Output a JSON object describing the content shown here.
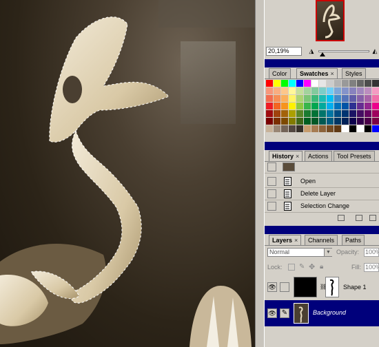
{
  "navigator": {
    "zoom": "20,19%"
  },
  "color_panel": {
    "tabs": [
      {
        "label": "Color",
        "active": false
      },
      {
        "label": "Swatches",
        "active": true
      },
      {
        "label": "Styles",
        "active": false
      }
    ],
    "swatch_colors": [
      "#ff0000",
      "#ffff00",
      "#00ff00",
      "#00ffff",
      "#0000ff",
      "#ff00ff",
      "#ffffff",
      "#e6e6e6",
      "#cccccc",
      "#b3b3b3",
      "#999999",
      "#808080",
      "#666666",
      "#4d4d4d",
      "#333333",
      "#f7977a",
      "#f9ad81",
      "#fdc68a",
      "#fff79a",
      "#c4df9b",
      "#a2d39c",
      "#82ca9d",
      "#7bcdc8",
      "#6ecff6",
      "#7ea7d8",
      "#8493ca",
      "#8882be",
      "#a187be",
      "#bc8dbf",
      "#f49ac2",
      "#f26c4f",
      "#f68e55",
      "#fbaf5c",
      "#fff467",
      "#acd372",
      "#7cc576",
      "#3bb878",
      "#1abbb4",
      "#00bff3",
      "#438cca",
      "#5574b9",
      "#605ca8",
      "#855fa8",
      "#a763a8",
      "#f06ea9",
      "#ed1c24",
      "#f26522",
      "#f7941d",
      "#fff200",
      "#8dc73f",
      "#39b54a",
      "#00a651",
      "#00a99d",
      "#00aeef",
      "#0072bc",
      "#0054a6",
      "#2e3192",
      "#662d91",
      "#92278f",
      "#ec008c",
      "#9e0b0f",
      "#a0410d",
      "#a3620a",
      "#aba000",
      "#598527",
      "#1a7b30",
      "#007236",
      "#00746b",
      "#0076a3",
      "#004b80",
      "#003471",
      "#1b1464",
      "#440e62",
      "#630460",
      "#9e005d",
      "#790000",
      "#7b2e00",
      "#7d4900",
      "#827b00",
      "#406618",
      "#005e20",
      "#005826",
      "#005952",
      "#005b7f",
      "#003663",
      "#002157",
      "#0d004c",
      "#32004b",
      "#4b0049",
      "#7b0046",
      "#c7b299",
      "#998675",
      "#736357",
      "#534741",
      "#37302a",
      "#c69c6d",
      "#a67c52",
      "#8c6239",
      "#754c24",
      "#603913",
      "#ffffff",
      "#000000",
      "#ffffff",
      "#000000",
      "#0000ff"
    ]
  },
  "history_panel": {
    "tabs": [
      {
        "label": "History",
        "active": true
      },
      {
        "label": "Actions",
        "active": false
      },
      {
        "label": "Tool Presets",
        "active": false
      }
    ],
    "items": [
      {
        "label": "Open"
      },
      {
        "label": "Delete Layer"
      },
      {
        "label": "Selection Change"
      }
    ]
  },
  "layers_panel": {
    "tabs": [
      {
        "label": "Layers",
        "active": true
      },
      {
        "label": "Channels",
        "active": false
      },
      {
        "label": "Paths",
        "active": false
      }
    ],
    "blend_mode": "Normal",
    "opacity_label": "Opacity:",
    "opacity_value": "100%",
    "lock_label": "Lock:",
    "fill_label": "Fill:",
    "fill_value": "100%",
    "layers": [
      {
        "name": "Shape 1",
        "selected": false
      },
      {
        "name": "Background",
        "selected": true
      }
    ]
  },
  "colors": {
    "panel_header": "#00007b",
    "selection": "#00007b",
    "panel_bg": "#d4d0c8"
  }
}
